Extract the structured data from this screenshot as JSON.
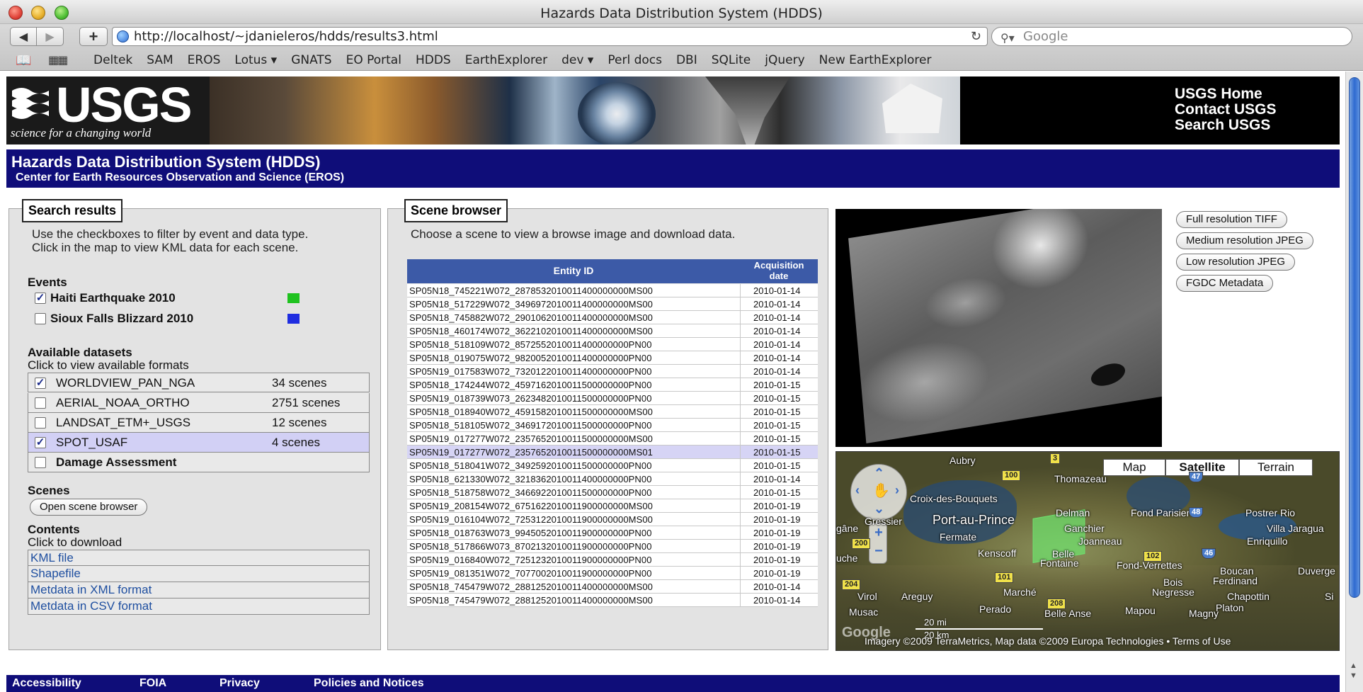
{
  "window": {
    "title": "Hazards Data Distribution System (HDDS)"
  },
  "browser": {
    "url": "http://localhost/~jdanieleros/hdds/results3.html",
    "search_placeholder": "Google",
    "bookmarks": [
      "Deltek",
      "SAM",
      "EROS",
      "Lotus ▾",
      "GNATS",
      "EO Portal",
      "HDDS",
      "EarthExplorer",
      "dev ▾",
      "Perl docs",
      "DBI",
      "SQLite",
      "jQuery",
      "New EarthExplorer"
    ]
  },
  "banner": {
    "logo": "USGS",
    "tagline": "science for a changing world",
    "links": [
      "USGS Home",
      "Contact USGS",
      "Search USGS"
    ]
  },
  "header": {
    "title": "Hazards Data Distribution System (HDDS)",
    "subtitle": "Center for Earth Resources Observation and Science (EROS)"
  },
  "search_results": {
    "legend": "Search results",
    "description_line1": "Use the checkboxes to filter by event and data type.",
    "description_line2": "Click in the map to view KML data for each scene.",
    "events_heading": "Events",
    "events": [
      {
        "label": "Haiti Earthquake 2010",
        "checked": true,
        "color": "#1fc21f"
      },
      {
        "label": "Sioux Falls Blizzard 2010",
        "checked": false,
        "color": "#1f2de0"
      }
    ],
    "datasets_heading": "Available datasets",
    "datasets_sub": "Click to view available formats",
    "datasets": [
      {
        "name": "WORLDVIEW_PAN_NGA",
        "count": "34 scenes",
        "checked": true
      },
      {
        "name": "AERIAL_NOAA_ORTHO",
        "count": "2751 scenes",
        "checked": false
      },
      {
        "name": "LANDSAT_ETM+_USGS",
        "count": "12 scenes",
        "checked": false
      },
      {
        "name": "SPOT_USAF",
        "count": "4 scenes",
        "checked": true
      },
      {
        "name": "Damage Assessment",
        "count": "",
        "checked": false
      }
    ],
    "scenes_heading": "Scenes",
    "open_scene_browser": "Open scene browser",
    "contents_heading": "Contents",
    "contents_sub": "Click to download",
    "contents": [
      "KML file",
      "Shapefile",
      "Metdata in XML format",
      "Metdata in CSV format"
    ]
  },
  "scene_browser": {
    "legend": "Scene browser",
    "description": "Choose a scene to view a browse image and download data.",
    "col_entity": "Entity ID",
    "col_date_line1": "Acquisition",
    "col_date_line2": "date",
    "rows": [
      [
        "SP05N18_745221W072_2878532010011400000000MS00",
        "2010-01-14"
      ],
      [
        "SP05N18_517229W072_3496972010011400000000MS00",
        "2010-01-14"
      ],
      [
        "SP05N18_745882W072_2901062010011400000000MS00",
        "2010-01-14"
      ],
      [
        "SP05N18_460174W072_3622102010011400000000MS00",
        "2010-01-14"
      ],
      [
        "SP05N18_518109W072_8572552010011400000000PN00",
        "2010-01-14"
      ],
      [
        "SP05N18_019075W072_9820052010011400000000PN00",
        "2010-01-14"
      ],
      [
        "SP05N19_017583W072_7320122010011400000000PN00",
        "2010-01-14"
      ],
      [
        "SP05N18_174244W072_4597162010011500000000PN00",
        "2010-01-15"
      ],
      [
        "SP05N19_018739W073_2623482010011500000000PN00",
        "2010-01-15"
      ],
      [
        "SP05N18_018940W072_4591582010011500000000MS00",
        "2010-01-15"
      ],
      [
        "SP05N18_518105W072_3469172010011500000000PN00",
        "2010-01-15"
      ],
      [
        "SP05N19_017277W072_2357652010011500000000MS00",
        "2010-01-15"
      ],
      [
        "SP05N19_017277W072_2357652010011500000000MS01",
        "2010-01-15"
      ],
      [
        "SP05N18_518041W072_3492592010011500000000PN00",
        "2010-01-15"
      ],
      [
        "SP05N18_621330W072_3218362010011400000000PN00",
        "2010-01-14"
      ],
      [
        "SP05N18_518758W072_3466922010011500000000PN00",
        "2010-01-15"
      ],
      [
        "SP05N19_208154W072_6751622010011900000000MS00",
        "2010-01-19"
      ],
      [
        "SP05N19_016104W072_7253122010011900000000MS00",
        "2010-01-19"
      ],
      [
        "SP05N18_018763W073_9945052010011900000000PN00",
        "2010-01-19"
      ],
      [
        "SP05N18_517866W073_8702132010011900000000PN00",
        "2010-01-19"
      ],
      [
        "SP05N19_016840W072_7251232010011900000000PN00",
        "2010-01-19"
      ],
      [
        "SP05N19_081351W072_7077002010011900000000PN00",
        "2010-01-19"
      ],
      [
        "SP05N18_745479W072_2881252010011400000000MS00",
        "2010-01-14"
      ],
      [
        "SP05N18_745479W072_2881252010011400000000MS00",
        "2010-01-14"
      ]
    ],
    "selected_index": 12
  },
  "downloads": [
    "Full resolution TIFF",
    "Medium resolution JPEG",
    "Low resolution JPEG",
    "FGDC Metadata"
  ],
  "map": {
    "types": [
      "Map",
      "Satellite",
      "Terrain"
    ],
    "active_type": "Satellite",
    "labels": {
      "aubry": "Aubry",
      "thomazeau": "Thomazeau",
      "croix": "Croix-des-Bouquets",
      "delman": "Delman",
      "fond_parisien": "Fond Parisien",
      "postrer": "Postrer Rio",
      "gressier": "Gressier",
      "pap": "Port-au-Prince",
      "ganchier": "Ganchier",
      "villa": "Villa Jaragua",
      "enriquillo": "Enriquillo",
      "gane": "gâne",
      "fermate": "Fermate",
      "joanneau": "Joanneau",
      "kenscoff": "Kenscoff",
      "belle": "Belle",
      "fontaine": "Fontaine",
      "fond_verrettes": "Fond-Verrettes",
      "boucan": "Boucan",
      "ferdinand": "Ferdinand",
      "duverge": "Duverge",
      "uche": "uche",
      "bois": "Bois",
      "negresse": "Negresse",
      "marche": "Marché",
      "chapotin": "Chapottin",
      "si": "Si",
      "virol": "Virol",
      "areguy": "Areguy",
      "platon": "Platon",
      "musac": "Musac",
      "perado": "Perado",
      "belle_anse": "Belle Anse",
      "mapou": "Mapou",
      "magny": "Magny"
    },
    "shields": [
      "3",
      "100",
      "47",
      "48",
      "200",
      "102",
      "46",
      "101",
      "204",
      "208"
    ],
    "scale_mi": "20 mi",
    "scale_km": "20 km",
    "google": "Google",
    "copyright": "Imagery ©2009 TerraMetrics, Map data ©2009 Europa Technologies • Terms of Use"
  },
  "footer": {
    "links": [
      "Accessibility",
      "FOIA",
      "Privacy",
      "Policies and Notices"
    ]
  }
}
